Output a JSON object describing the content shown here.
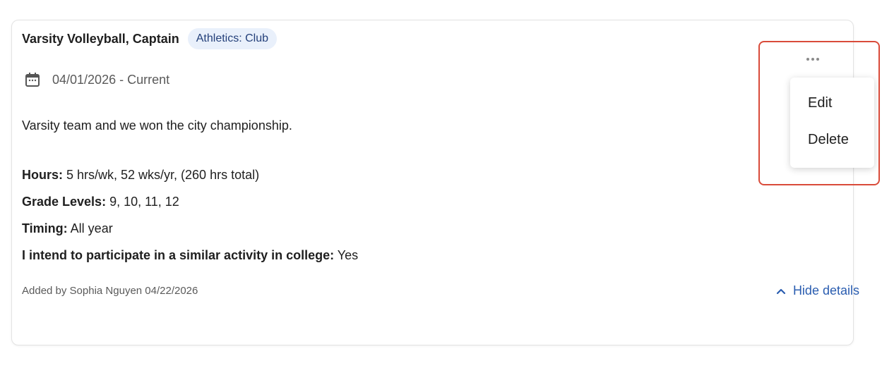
{
  "activity": {
    "title": "Varsity Volleyball, Captain",
    "badge": "Athletics: Club",
    "date_range": "04/01/2026 - Current",
    "description": "Varsity team and we won the city championship.",
    "details": [
      {
        "label": "Hours:",
        "value": " 5 hrs/wk, 52 wks/yr, (260 hrs total)"
      },
      {
        "label": "Grade Levels:",
        "value": " 9, 10, 11, 12"
      },
      {
        "label": "Timing:",
        "value": " All year"
      },
      {
        "label": "I intend to participate in a similar activity in college:",
        "value": " Yes"
      }
    ],
    "added_by": "Added by Sophia Nguyen 04/22/2026",
    "hide_details_label": "Hide details"
  },
  "menu": {
    "edit_label": "Edit",
    "delete_label": "Delete"
  },
  "colors": {
    "accent": "#2a5db0",
    "badge_bg": "#e9f0fb",
    "highlight": "#d94b3a"
  }
}
